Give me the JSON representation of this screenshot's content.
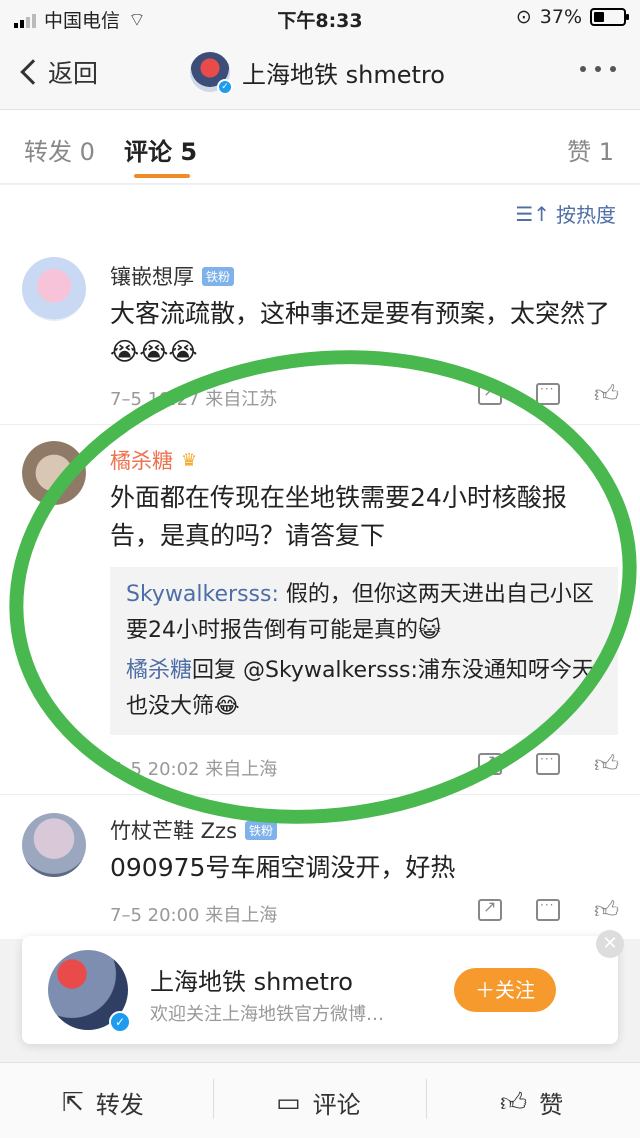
{
  "status_bar": {
    "carrier": "中国电信",
    "time": "下午8:33",
    "battery_percent": "37%",
    "battery_level": 0.37
  },
  "nav": {
    "back_label": "返回",
    "title": "上海地铁 shmetro"
  },
  "tabs": [
    {
      "label": "转发 0",
      "active": false
    },
    {
      "label": "评论 5",
      "active": true
    },
    {
      "label": "赞 1",
      "active": false
    }
  ],
  "sort_label": "按热度",
  "comments": [
    {
      "name": "镶嵌想厚",
      "badge": "铁粉",
      "text": "大客流疏散，这种事还是要有预案，太突然了😭😭😭",
      "meta": "7–5 19:27  来自江苏"
    },
    {
      "name": "橘杀糖",
      "text": "外面都在传现在坐地铁需要24小时核酸报告，是真的吗？请答复下",
      "replies": [
        {
          "user": "Skywalkersss:",
          "text": " 假的，但你这两天进出自己小区要24小时报告倒有可能是真的😺"
        },
        {
          "user": "橘杀糖",
          "text": "回复 @Skywalkersss:浦东没通知呀今天也没大筛😂"
        }
      ],
      "meta": "7–5 20:02  来自上海"
    },
    {
      "name": "竹杖芒鞋 Zzs",
      "badge": "铁粉",
      "text": "090975号车厢空调没开，好热",
      "meta": "7–5 20:00  来自上海"
    }
  ],
  "follow_card": {
    "name": "上海地铁 shmetro",
    "desc": "欢迎关注上海地铁官方微博…",
    "button": "＋关注"
  },
  "bottom_bar": {
    "repost": "转发",
    "comment": "评论",
    "like": "赞"
  },
  "colors": {
    "accent_orange": "#f08b2a",
    "link_blue": "#4e6ea7",
    "highlight_green": "#48b84f"
  }
}
